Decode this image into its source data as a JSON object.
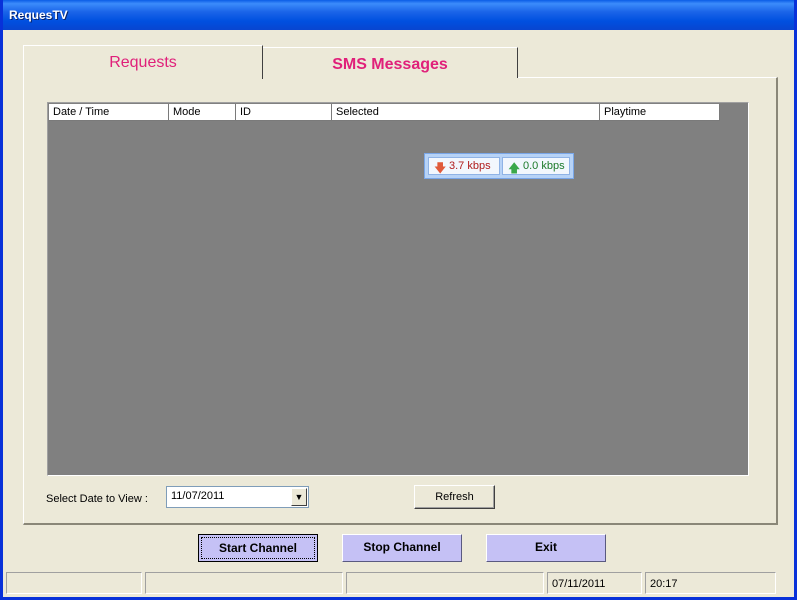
{
  "window": {
    "title": "RequesTV"
  },
  "tabs": [
    {
      "label": "Requests",
      "active": true
    },
    {
      "label": "SMS Messages",
      "active": false
    }
  ],
  "list": {
    "columns": [
      "Date / Time",
      "Mode",
      "ID",
      "Selected",
      "Playtime"
    ],
    "rows": []
  },
  "net_meter": {
    "download": "3.7 kbps",
    "upload": "0.0 kbps"
  },
  "date_filter": {
    "label": "Select Date to View :",
    "value": "11/07/2011"
  },
  "buttons": {
    "refresh": "Refresh",
    "start": "Start Channel",
    "stop": "Stop Channel",
    "exit": "Exit"
  },
  "status": {
    "date": "07/11/2011",
    "time": "20:17"
  },
  "colors": {
    "tab_text": "#e0207a",
    "action_button": "#c5c1f5",
    "list_background": "#808080"
  }
}
